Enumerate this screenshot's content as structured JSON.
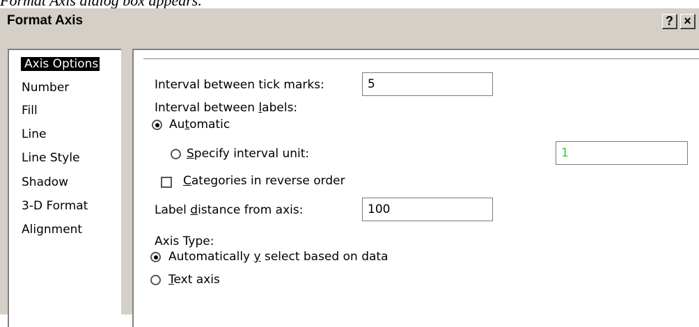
{
  "caption": "Format Axis dialog box appears.",
  "dialog": {
    "title": "Format Axis",
    "help_label": "?",
    "close_label": "×"
  },
  "categories": [
    {
      "label": "Axis Options",
      "selected": true
    },
    {
      "label": "Number"
    },
    {
      "label": "Fill"
    },
    {
      "label": "Line"
    },
    {
      "label": "Line Style"
    },
    {
      "label": "Shadow"
    },
    {
      "label": "3-D Format"
    },
    {
      "label": "Alignment"
    }
  ],
  "axis_options": {
    "tick_interval": {
      "label": "Interval between tick marks:",
      "value": "5"
    },
    "label_interval": {
      "label_pre": "Interval between ",
      "label_u": "l",
      "label_post": "abels:",
      "automatic": {
        "pre": "Au",
        "u": "t",
        "post": "omatic",
        "checked": true
      },
      "specify": {
        "pre": "",
        "u": "S",
        "post": "pecify interval unit:",
        "checked": false,
        "value": "1",
        "value_color": "#33cc33"
      }
    },
    "reverse_order": {
      "pre": "",
      "u": "C",
      "post": "ategories in reverse order",
      "checked": false
    },
    "label_distance": {
      "pre": "Label ",
      "u": "d",
      "post": "istance from axis:",
      "value": "100"
    },
    "axis_type": {
      "label": "Axis Type:",
      "auto": {
        "pre": "Automatically ",
        "u": "y",
        "post": " select based on data",
        "checked": true
      },
      "text_axis": {
        "pre": "",
        "u": "T",
        "post": "ext axis",
        "checked": false
      }
    }
  }
}
